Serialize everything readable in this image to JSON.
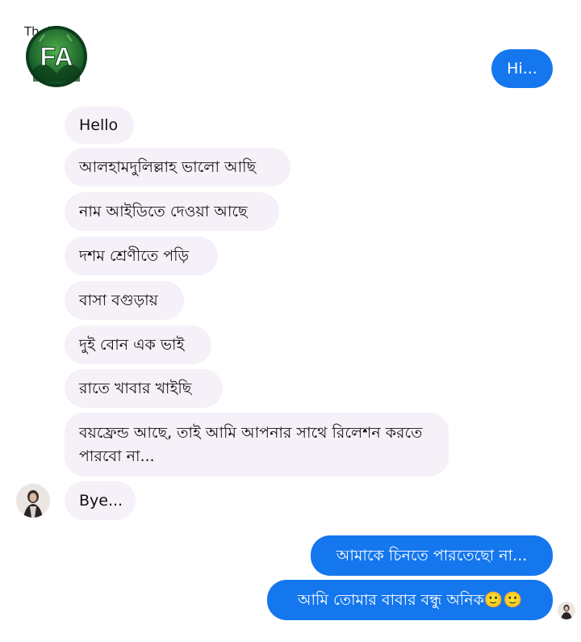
{
  "header": {
    "title_partial": "Th        doy",
    "logo_text": "FA"
  },
  "messages": {
    "sent_1": "Hi...",
    "recv_1": "Hello",
    "recv_2": "আলহামদুলিল্লাহ ভালো আছি",
    "recv_3": "নাম আইডিতে দেওয়া আছে",
    "recv_4": "দশম শ্রেণীতে পড়ি",
    "recv_5": "বাসা বগুড়ায়",
    "recv_6": "দুই বোন এক ভাই",
    "recv_7": "রাতে খাবার খাইছি",
    "recv_8": "বয়ফ্রেন্ড আছে, তাই আমি আপনার সাথে রিলেশন করতে পারবো না...",
    "recv_9": "Bye...",
    "sent_2": "আমাকে চিনতে পারতেছো না...",
    "sent_3": "আমি তোমার বাবার বন্ধু অনিক🙂🙂"
  },
  "colors": {
    "sent_bubble": "#1577ee",
    "received_bubble": "#f6f0f8",
    "logo_green": "#2e8b3a"
  }
}
